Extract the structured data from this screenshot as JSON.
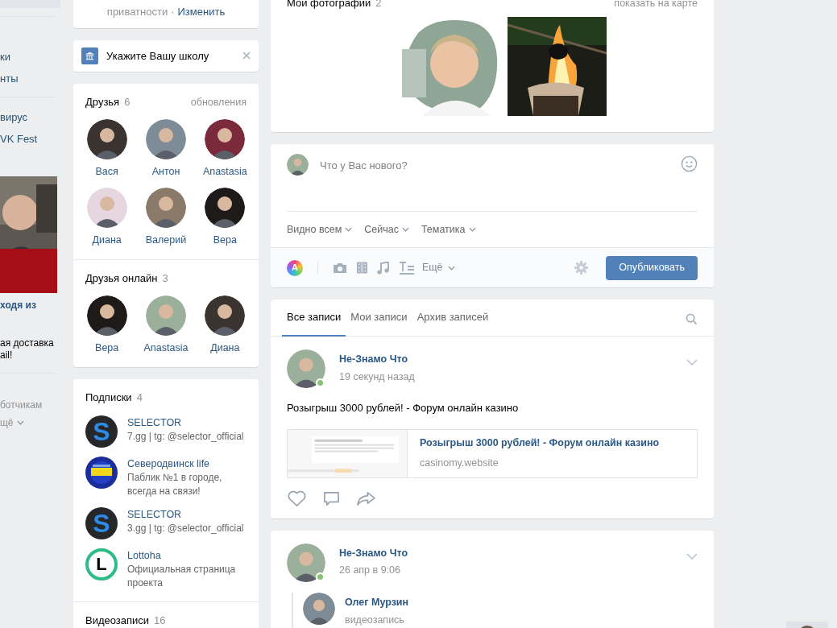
{
  "left_sidebar": {
    "nav_groups": [
      [
        "ки",
        "нты"
      ],
      [
        "вирус",
        "VK Fest"
      ]
    ],
    "ad": {
      "kind": "picture",
      "title": "ходя из",
      "lines": [
        "ая доставка",
        "ail!"
      ]
    },
    "footer_link": "ботчикам",
    "more_link": "щё"
  },
  "privacy_card": {
    "text": "приватности",
    "separator": "·",
    "link": "Изменить"
  },
  "school_card": {
    "text": "Укажите Вашу школу"
  },
  "friends": {
    "title": "Друзья",
    "count": "6",
    "link": "обновления",
    "items": [
      {
        "name": "Вася"
      },
      {
        "name": "Антон"
      },
      {
        "name": "Anastasia"
      },
      {
        "name": "Диана"
      },
      {
        "name": "Валерий"
      },
      {
        "name": "Вера"
      }
    ]
  },
  "friends_online": {
    "title": "Друзья онлайн",
    "count": "3",
    "items": [
      {
        "name": "Вера"
      },
      {
        "name": "Anastasia"
      },
      {
        "name": "Диана"
      }
    ]
  },
  "subscriptions": {
    "title": "Подписки",
    "count": "4",
    "items": [
      {
        "name": "SELECTOR",
        "description": "7.gg | tg: @selector_official",
        "logo": {
          "kind": "letter",
          "text": "S"
        }
      },
      {
        "name": "Северодвинск life",
        "description": "Паблик №1 в городе, всегда на связи!"
      },
      {
        "name": "SELECTOR",
        "description": "3.gg | tg: @selector_official",
        "logo": {
          "kind": "letter",
          "text": "S"
        }
      },
      {
        "name": "Lottoha",
        "description": "Официальная страница проекта",
        "logo": {
          "kind": "ring",
          "text": "L"
        }
      }
    ]
  },
  "videos": {
    "title": "Видеозаписи",
    "count": "16"
  },
  "photos": {
    "title": "Мои фотографии",
    "count": "2",
    "link": "показать на карте"
  },
  "composer": {
    "placeholder": "Что у Вас нового?",
    "options": [
      "Видно всем",
      "Сейчас",
      "Тематика"
    ],
    "art_letter": "A",
    "more": "Ещё",
    "submit": "Опубликовать"
  },
  "feed_tabs": [
    {
      "label": "Все записи",
      "selected": true
    },
    {
      "label": "Мои записи",
      "selected": false
    },
    {
      "label": "Архив записей",
      "selected": false
    }
  ],
  "posts": [
    {
      "author": "Не-Знамо Что",
      "online": true,
      "time": "19 секунд назад",
      "text": "Розыгрыш 3000 рублей! - Форум онлайн казино",
      "link": {
        "title": "Розыгрыш 3000 рублей! - Форум онлайн казино",
        "domain": "casinomy.website"
      }
    },
    {
      "author": "Не-Знамо Что",
      "online": true,
      "time": "26 апр в 9:06",
      "repost": {
        "author": "Олег Мурзин",
        "subtitle": "видеозапись"
      }
    }
  ]
}
